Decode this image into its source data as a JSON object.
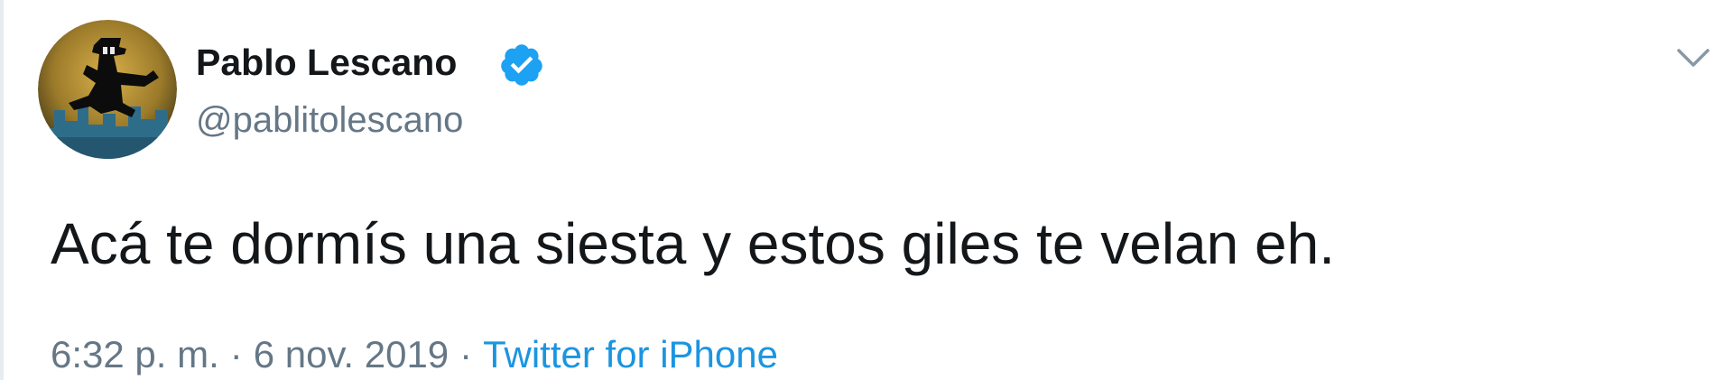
{
  "tweet": {
    "author": {
      "display_name": "Pablo Lescano",
      "handle": "@pablitolescano",
      "verified": true,
      "avatar_icon": "avatar-jumping-figure-icon"
    },
    "text": "Acá te dormís una siesta y estos giles te velan eh.",
    "time": "6:32 p. m.",
    "separator": "·",
    "date": "6 nov. 2019",
    "source": "Twitter for iPhone",
    "menu_icon": "chevron-down-icon"
  },
  "colors": {
    "text": "#14171a",
    "muted": "#657786",
    "link": "#1b95e0",
    "verified_badge": "#1da1f2"
  }
}
